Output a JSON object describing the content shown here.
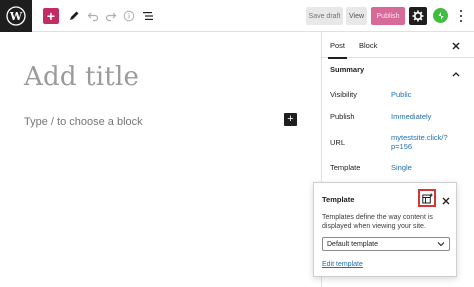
{
  "toolbar": {
    "save_draft": "Save draft",
    "view": "View",
    "publish": "Publish",
    "add_block": "+",
    "colors": {
      "accent": "#c32b67",
      "publish_bg": "#d86a9a",
      "jetpack": "#3fbe3f"
    }
  },
  "editor": {
    "title_placeholder": "Add title",
    "block_placeholder": "Type / to choose a block",
    "add_block_symbol": "+"
  },
  "sidebar": {
    "tabs": [
      {
        "label": "Post"
      },
      {
        "label": "Block"
      }
    ],
    "close_symbol": "✕",
    "summary_title": "Summary",
    "rows": [
      {
        "label": "Visibility",
        "value": "Public"
      },
      {
        "label": "Publish",
        "value": "Immediately"
      },
      {
        "label": "URL",
        "value": "mytestsite.click/?p=156"
      },
      {
        "label": "Template",
        "value": "Single"
      }
    ],
    "link_color": "#2271b1"
  },
  "template_popover": {
    "title": "Template",
    "close_symbol": "✕",
    "description": "Templates define the way content is displayed when viewing your site.",
    "select_value": "Default template",
    "edit_link": "Edit template",
    "highlight_color": "#d63638"
  }
}
